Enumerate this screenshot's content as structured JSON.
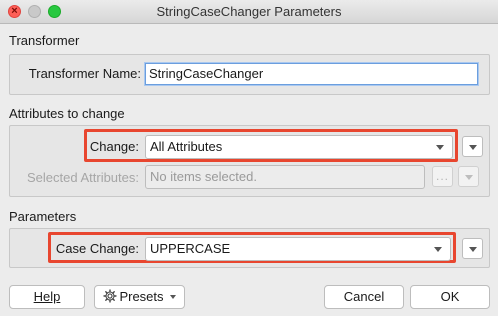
{
  "window": {
    "title": "StringCaseChanger Parameters",
    "close_glyph": "×"
  },
  "transformer": {
    "section_title": "Transformer",
    "name_label": "Transformer Name:",
    "name_value": "StringCaseChanger"
  },
  "attributes": {
    "section_title": "Attributes to change",
    "change_label": "Change:",
    "change_value": "All Attributes",
    "selected_label": "Selected Attributes:",
    "selected_placeholder": "No items selected.",
    "ellipsis_glyph": "..."
  },
  "parameters": {
    "section_title": "Parameters",
    "case_label": "Case Change:",
    "case_value": "UPPERCASE"
  },
  "buttons": {
    "help": "Help",
    "presets": "Presets",
    "cancel": "Cancel",
    "ok": "OK"
  },
  "colors": {
    "highlight": "#e8462f",
    "focus_border": "#6b9ede",
    "close_button": "#fe5f57",
    "maximize_button": "#28c840"
  },
  "icons": {
    "presets": "gear-icon",
    "dropdown": "chevron-down-icon"
  }
}
